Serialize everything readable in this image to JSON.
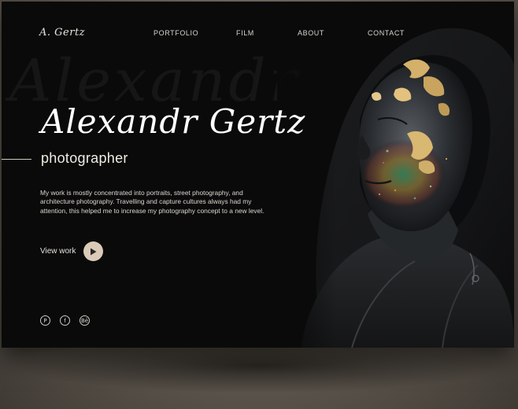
{
  "brand": {
    "logo": "A. Gertz"
  },
  "nav": {
    "items": [
      {
        "label": "PORTFOLIO"
      },
      {
        "label": "FILM"
      },
      {
        "label": "ABOUT"
      },
      {
        "label": "CONTACT"
      }
    ]
  },
  "hero": {
    "watermark": "Alexandr",
    "title": "Alexandr Gertz",
    "subtitle": "photographer",
    "description": "My work is mostly concentrated into portraits, street photography, and architecture photography. Travelling and capture cultures always had my attention, this helped me to increase my photography concept to a new level.",
    "cta_label": "View work"
  },
  "social": [
    {
      "icon": "pinterest-icon",
      "glyph": "P"
    },
    {
      "icon": "facebook-icon",
      "glyph": "f"
    },
    {
      "icon": "behance-icon",
      "glyph": "Bē"
    }
  ],
  "colors": {
    "background": "#0a0a0a",
    "accent": "#d9cbb8",
    "text": "#ffffff",
    "frame": "#6b6359"
  }
}
